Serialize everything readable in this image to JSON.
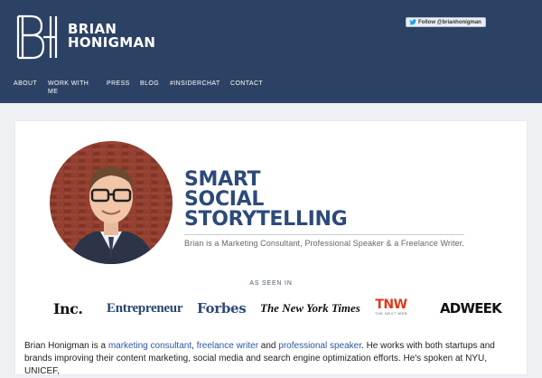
{
  "header": {
    "logo_text_line1": "BRIAN",
    "logo_text_line2": "HONIGMAN",
    "twitter_follow_label": "Follow @brianhonigman",
    "colors": {
      "background": "#2c4265",
      "text": "#ffffff"
    }
  },
  "nav": {
    "items": [
      {
        "label": "ABOUT"
      },
      {
        "label": "WORK WITH ME"
      },
      {
        "label": "PRESS"
      },
      {
        "label": "BLOG"
      },
      {
        "label": "#INSIDERCHAT"
      },
      {
        "label": "CONTACT"
      }
    ]
  },
  "hero": {
    "headline_line1": "SMART",
    "headline_line2": "SOCIAL",
    "headline_line3": "STORYTELLING",
    "tagline": "Brian is a Marketing Consultant, Professional Speaker & a Freelance Writer.",
    "headline_color": "#2c4a7a"
  },
  "press": {
    "heading": "AS SEEN IN",
    "logos": {
      "inc": "Inc.",
      "entrepreneur": "Entrepreneur",
      "forbes": "Forbes",
      "nyt": "The New York Times",
      "tnw": "TNW",
      "tnw_sub": "THE NEXT WEB",
      "adweek": "ADWEEK"
    }
  },
  "bio": {
    "p1": "Brian Honigman is a ",
    "link1": "marketing consultant",
    "p2": ", ",
    "link2": "freelance writer",
    "p3": " and ",
    "link3": "professional speaker",
    "p4": ". He works with both startups and brands improving their content marketing, social media and search engine optimization efforts. He's spoken at NYU, UNICEF,"
  }
}
